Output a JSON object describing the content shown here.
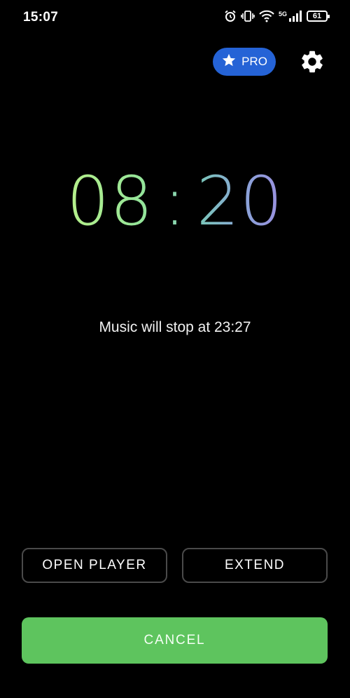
{
  "status_bar": {
    "time": "15:07",
    "network_label": "5G",
    "battery_level": "61",
    "icons": [
      "alarm-icon",
      "vibrate-icon",
      "wifi-icon",
      "signal-icon",
      "battery-icon"
    ]
  },
  "header": {
    "pro_label": "PRO",
    "pro_icon": "star-icon",
    "pro_color": "#2563d6",
    "settings_icon": "gear-icon"
  },
  "timer": {
    "minutes": "08",
    "separator": ":",
    "seconds": "20"
  },
  "message": "Music will stop at 23:27",
  "actions": {
    "open_player": "OPEN PLAYER",
    "extend": "EXTEND",
    "cancel": "CANCEL",
    "cancel_color": "#5ec45e"
  }
}
